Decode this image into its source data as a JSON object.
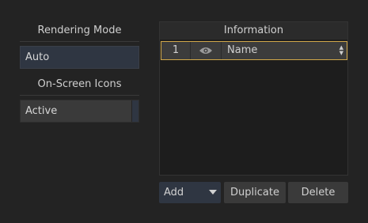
{
  "rendering": {
    "heading": "Rendering Mode",
    "value": "Auto"
  },
  "icons": {
    "heading": "On-Screen Icons",
    "value": "Active"
  },
  "panel": {
    "title": "Information",
    "rows": [
      {
        "index": "1",
        "icon": "eye-icon",
        "name": "Name"
      }
    ]
  },
  "buttons": {
    "add": "Add",
    "duplicate": "Duplicate",
    "delete": "Delete"
  },
  "colors": {
    "selection_border": "#d1a84a",
    "accent_field": "#2f3642"
  }
}
